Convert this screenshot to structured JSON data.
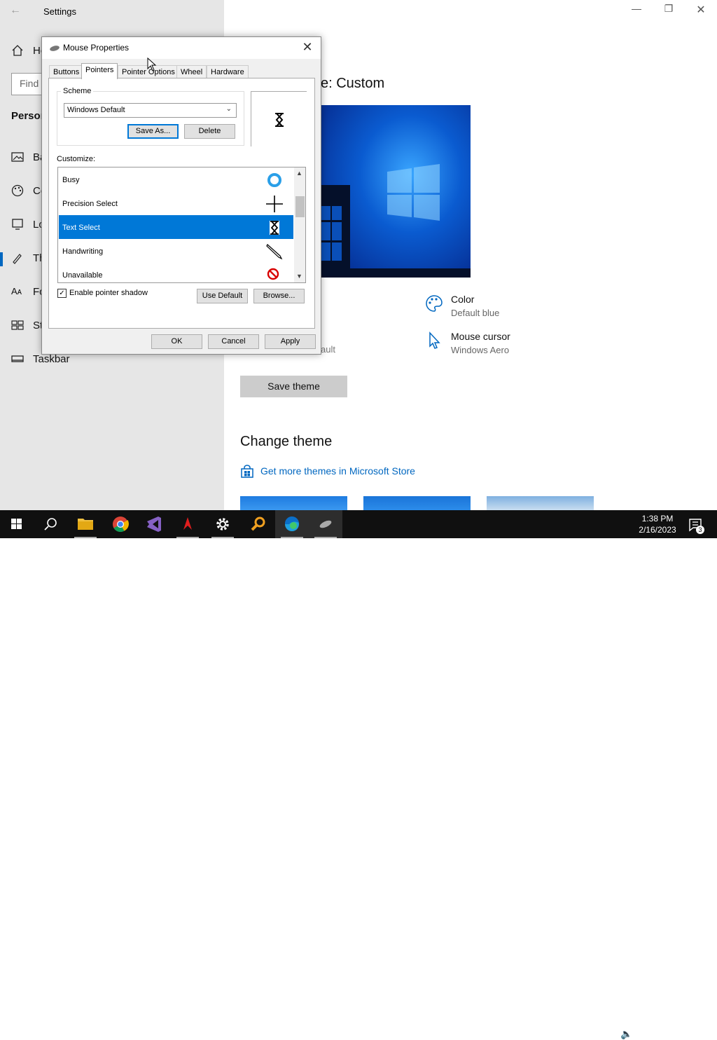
{
  "settings": {
    "title": "Settings",
    "search_placeholder": "Find",
    "section_heading": "Person",
    "sidebar": [
      {
        "label": "Ho",
        "icon": "home-icon"
      },
      {
        "label": "Ba",
        "icon": "background-icon"
      },
      {
        "label": "Co",
        "icon": "colors-icon"
      },
      {
        "label": "Lo",
        "icon": "lock-screen-icon"
      },
      {
        "label": "Th",
        "icon": "themes-icon"
      },
      {
        "label": "Fo",
        "icon": "fonts-icon"
      },
      {
        "label": "St",
        "icon": "start-icon"
      },
      {
        "label": "Taskbar",
        "icon": "taskbar-icon"
      }
    ]
  },
  "main": {
    "theme_title": "e: Custom",
    "color_title": "Color",
    "color_value": "Default blue",
    "cursor_title": "Mouse cursor",
    "cursor_value": "Windows Aero",
    "partial_text": "ault",
    "save_theme": "Save theme",
    "change_theme": "Change theme",
    "store_link": "Get more themes in Microsoft Store"
  },
  "dialog": {
    "title": "Mouse Properties",
    "tabs": [
      "Buttons",
      "Pointers",
      "Pointer Options",
      "Wheel",
      "Hardware"
    ],
    "active_tab": "Pointers",
    "scheme_label": "Scheme",
    "scheme_value": "Windows Default",
    "save_as": "Save As...",
    "delete": "Delete",
    "customize_label": "Customize:",
    "rows": [
      {
        "label": "Busy",
        "icon": "busy-ring-icon"
      },
      {
        "label": "Precision Select",
        "icon": "crosshair-icon"
      },
      {
        "label": "Text Select",
        "icon": "hourglass-icon",
        "selected": true
      },
      {
        "label": "Handwriting",
        "icon": "pen-icon"
      },
      {
        "label": "Unavailable",
        "icon": "unavailable-icon"
      }
    ],
    "shadow_label": "Enable pointer shadow",
    "shadow_checked": true,
    "use_default": "Use Default",
    "browse": "Browse...",
    "ok": "OK",
    "cancel": "Cancel",
    "apply": "Apply"
  },
  "taskbar": {
    "time": "1:38 PM",
    "date": "2/16/2023",
    "notification_count": "3"
  },
  "colors": {
    "accent": "#0078d7",
    "link": "#0067c0",
    "sidebar_bg": "#e6e6e6",
    "taskbar_bg": "#101010"
  }
}
